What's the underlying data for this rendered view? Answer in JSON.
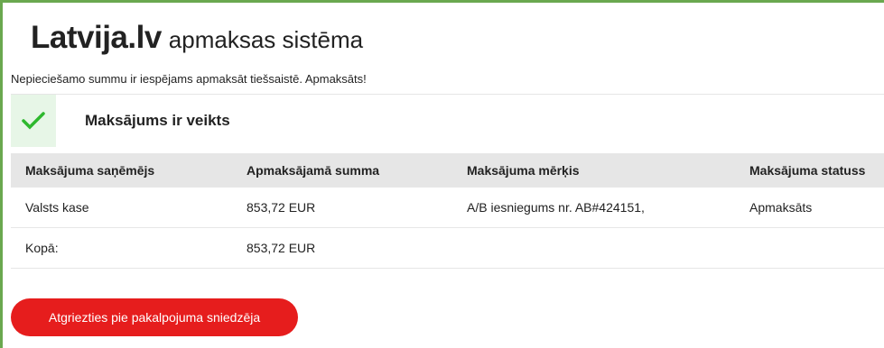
{
  "header": {
    "logo_text": "Latvija.lv",
    "subtitle": "apmaksas sistēma"
  },
  "notice": "Nepieciešamo summu ir iespējams apmaksāt tiešsaistē. Apmaksāts!",
  "status": {
    "title": "Maksājums ir veikts",
    "icon": "check-icon",
    "color": "#2eb82e"
  },
  "table": {
    "headers": [
      "Maksājuma saņēmējs",
      "Apmaksājamā summa",
      "Maksājuma mērķis",
      "Maksājuma statuss"
    ],
    "rows": [
      [
        "Valsts kase",
        "853,72 EUR",
        "A/B iesniegums nr. AB#424151,",
        "Apmaksāts"
      ]
    ],
    "total": {
      "label": "Kopā:",
      "amount": "853,72 EUR"
    }
  },
  "button": {
    "label": "Atgriezties pie pakalpojuma sniedzēja",
    "color": "#e61d1d"
  }
}
